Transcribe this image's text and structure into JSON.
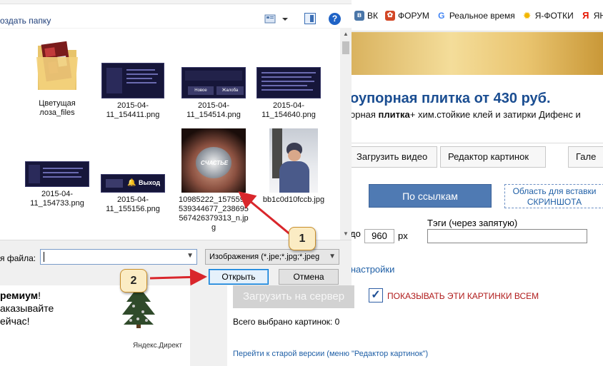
{
  "bookmarks": [
    {
      "icon": "vk-icon",
      "label": "ВК",
      "color": "#4a76a8"
    },
    {
      "icon": "forum-icon",
      "label": "ФОРУМ",
      "color": "#d24726"
    },
    {
      "icon": "google-icon",
      "label": "Реальное время",
      "color": "#4285f4"
    },
    {
      "icon": "yandex-fotki-icon",
      "label": "Я-ФОТКИ",
      "color": "#f2b600"
    },
    {
      "icon": "yandex-icon",
      "label": "ЯНД",
      "color": "#e61400"
    }
  ],
  "ad": {
    "title": "оупорная плитка от 430 руб.",
    "subtitle_before": "орная ",
    "subtitle_bold": "плитка",
    "subtitle_after": "+ хим.стойкие клей и затирки Дифенс и"
  },
  "page_tabs": [
    "Загрузить видео",
    "Редактор картинок",
    "Гале"
  ],
  "page": {
    "by_link_button": "По ссылкам",
    "screenshot_area": "Область для вставки СКРИНШОТА",
    "size_prefix": "до",
    "size_value": "960",
    "size_unit": "px",
    "tags_label": "Тэги (через запятую)",
    "settings_link": "е настройки",
    "upload_button": "Загрузить на сервер",
    "show_all_label": "ПОКАЗЫВАТЬ ЭТИ КАРТИНКИ ВСЕМ",
    "total_selected": "Всего выбрано картинок: 0",
    "old_version_link": "Перейти к старой версии (меню \"Редактор картинок\")"
  },
  "left_ad": {
    "line1_bold": "ремиум",
    "line1_rest": "!",
    "line2": "аказывайте",
    "line3": "ейчас!",
    "source": "Яндекс.Директ"
  },
  "dialog": {
    "new_folder": "оздать папку",
    "files": [
      {
        "name": "Цветущая лоза_files",
        "kind": "folder"
      },
      {
        "name": "2015-04-11_154411.png",
        "kind": "screenshot"
      },
      {
        "name": "2015-04-11_154514.png",
        "kind": "screenshot"
      },
      {
        "name": "2015-04-11_154640.png",
        "kind": "screenshot"
      },
      {
        "name": "10985222_1575590539344677_238695567426379313_n.jpg",
        "kind": "photo-hands"
      },
      {
        "name": "bb1c0d10fccb.jpg",
        "kind": "photo-person"
      },
      {
        "name": "2015-04-11_154733.png",
        "kind": "screenshot"
      },
      {
        "name": "2015-04-11_155156.png",
        "kind": "screenshot"
      }
    ],
    "shot_labels": {
      "exit": "Выход",
      "news": "Новое",
      "complaint": "Жалоба",
      "happiness": "СЧАСТЬЕ"
    },
    "filename_label": "я файла:",
    "filename_value": "",
    "filetype_value": "Изображения (*.jpe;*.jpg;*.jpeg",
    "open_button": "Открыть",
    "cancel_button": "Отмена"
  },
  "callouts": [
    "1",
    "2"
  ],
  "colors": {
    "accent": "#0078d7",
    "arrow": "#d9262b",
    "link": "#1f5fa6"
  }
}
